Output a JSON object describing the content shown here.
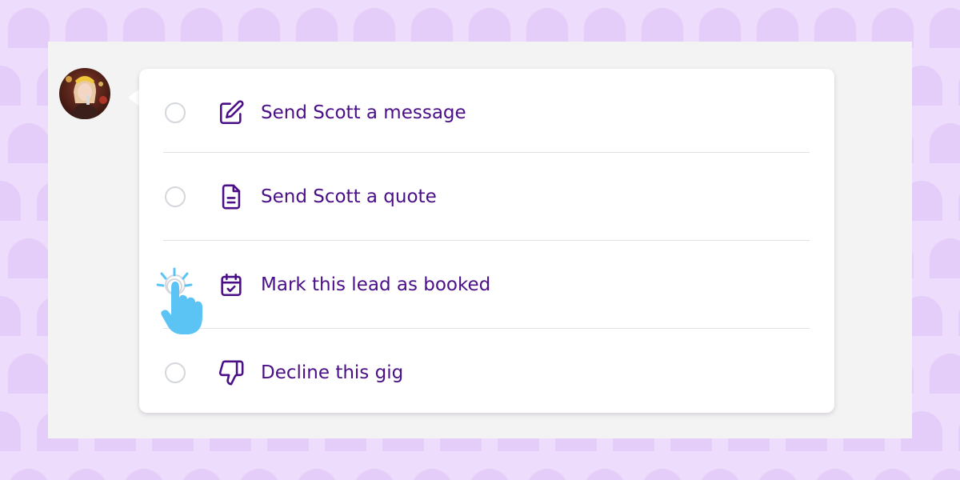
{
  "colors": {
    "background": "#eddcfb",
    "pattern": "#e2c9f7",
    "panel": "#f3f3f3",
    "accent": "#4a0e87",
    "radio_border": "#d4d7dc",
    "cursor": "#5cc3f5"
  },
  "user": {
    "avatar_icon": "user-photo"
  },
  "actions": [
    {
      "label": "Send Scott a message",
      "icon": "edit-icon",
      "selected": false
    },
    {
      "label": "Send Scott a quote",
      "icon": "document-icon",
      "selected": false
    },
    {
      "label": "Mark this lead as booked",
      "icon": "calendar-check-icon",
      "selected": false
    },
    {
      "label": "Decline this gig",
      "icon": "thumbs-down-icon",
      "selected": false
    }
  ],
  "pointer": {
    "icon": "hand-pointer-click-icon"
  }
}
